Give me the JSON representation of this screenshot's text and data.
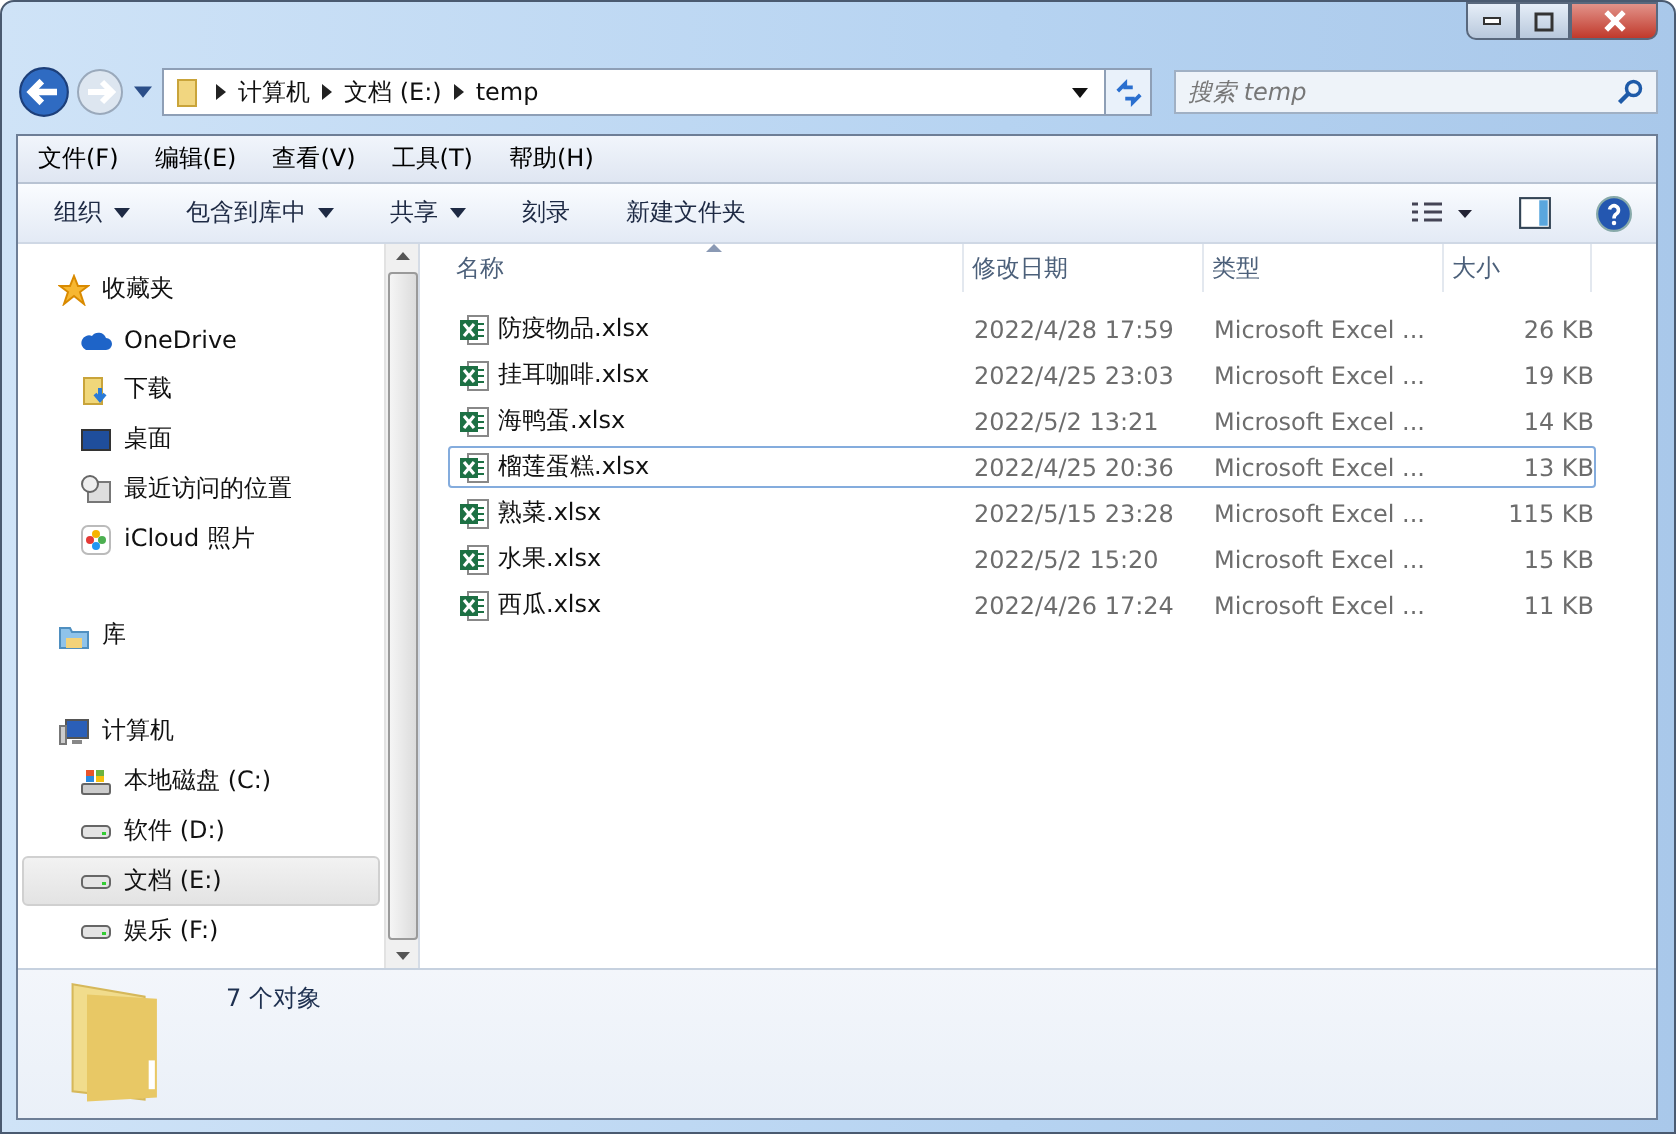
{
  "breadcrumb": [
    "计算机",
    "文档 (E:)",
    "temp"
  ],
  "search": {
    "placeholder": "搜索 temp"
  },
  "menu": [
    "文件(F)",
    "编辑(E)",
    "查看(V)",
    "工具(T)",
    "帮助(H)"
  ],
  "commands": [
    {
      "label": "组织",
      "dropdown": true
    },
    {
      "label": "包含到库中",
      "dropdown": true
    },
    {
      "label": "共享",
      "dropdown": true
    },
    {
      "label": "刻录",
      "dropdown": false
    },
    {
      "label": "新建文件夹",
      "dropdown": false
    }
  ],
  "sidebar": [
    {
      "label": "收藏夹",
      "kind": "star",
      "selected": false,
      "children": [
        {
          "label": "OneDrive",
          "kind": "cloud",
          "selected": false
        },
        {
          "label": "下载",
          "kind": "download",
          "selected": false
        },
        {
          "label": "桌面",
          "kind": "desktop",
          "selected": false
        },
        {
          "label": "最近访问的位置",
          "kind": "recent",
          "selected": false
        },
        {
          "label": "iCloud 照片",
          "kind": "photos",
          "selected": false
        }
      ]
    },
    {
      "label": "库",
      "kind": "library",
      "selected": false
    },
    {
      "label": "计算机",
      "kind": "computer",
      "selected": false,
      "children": [
        {
          "label": "本地磁盘 (C:)",
          "kind": "sysdrive",
          "selected": false
        },
        {
          "label": "软件 (D:)",
          "kind": "drive",
          "selected": false
        },
        {
          "label": "文档 (E:)",
          "kind": "drive",
          "selected": true
        },
        {
          "label": "娱乐 (F:)",
          "kind": "drive",
          "selected": false
        }
      ]
    }
  ],
  "columns": [
    {
      "label": "名称",
      "sorted": true
    },
    {
      "label": "修改日期",
      "sorted": false
    },
    {
      "label": "类型",
      "sorted": false
    },
    {
      "label": "大小",
      "sorted": false
    }
  ],
  "files": [
    {
      "name": "防疫物品.xlsx",
      "date": "2022/4/28 17:59",
      "type": "Microsoft Excel ...",
      "size": "26 KB",
      "selected": false
    },
    {
      "name": "挂耳咖啡.xlsx",
      "date": "2022/4/25 23:03",
      "type": "Microsoft Excel ...",
      "size": "19 KB",
      "selected": false
    },
    {
      "name": "海鸭蛋.xlsx",
      "date": "2022/5/2 13:21",
      "type": "Microsoft Excel ...",
      "size": "14 KB",
      "selected": false
    },
    {
      "name": "榴莲蛋糕.xlsx",
      "date": "2022/4/25 20:36",
      "type": "Microsoft Excel ...",
      "size": "13 KB",
      "selected": true
    },
    {
      "name": "熟菜.xlsx",
      "date": "2022/5/15 23:28",
      "type": "Microsoft Excel ...",
      "size": "115 KB",
      "selected": false
    },
    {
      "name": "水果.xlsx",
      "date": "2022/5/2 15:20",
      "type": "Microsoft Excel ...",
      "size": "15 KB",
      "selected": false
    },
    {
      "name": "西瓜.xlsx",
      "date": "2022/4/26 17:24",
      "type": "Microsoft Excel ...",
      "size": "11 KB",
      "selected": false
    }
  ],
  "status": "7 个对象"
}
